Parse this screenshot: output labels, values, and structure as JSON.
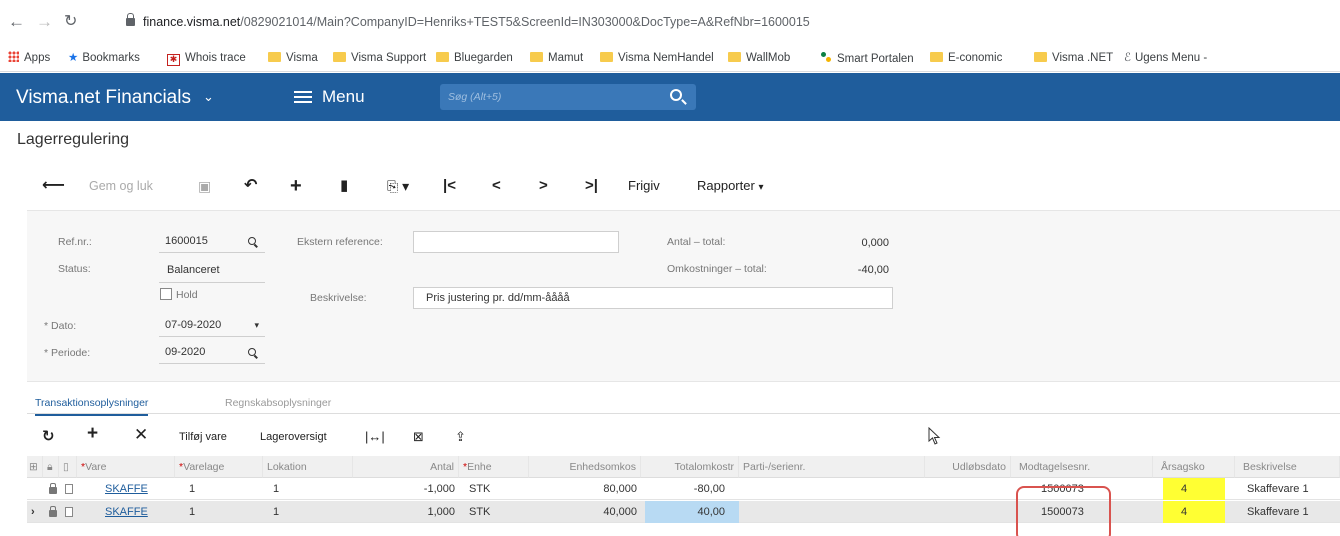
{
  "browser": {
    "url_host": "finance.visma.net",
    "url_path": "/0829021014/Main?CompanyID=Henriks+TEST5&ScreenId=IN303000&DocType=A&RefNbr=1600015",
    "bookmarks": [
      "Apps",
      "Bookmarks",
      "Whois trace",
      "Visma",
      "Visma Support",
      "Bluegarden",
      "Mamut",
      "Visma NemHandel",
      "WallMob",
      "Smart Portalen",
      "E-conomic",
      "Visma .NET",
      "Ugens Menu -"
    ]
  },
  "header": {
    "app_title": "Visma.net Financials",
    "menu_label": "Menu",
    "search_placeholder": "Søg (Alt+5)"
  },
  "page": {
    "title": "Lagerregulering"
  },
  "toolbar": {
    "save_close": "Gem og luk",
    "release": "Frigiv",
    "reports": "Rapporter"
  },
  "form": {
    "ref_label": "Ref.nr.:",
    "ref_value": "1600015",
    "status_label": "Status:",
    "status_value": "Balanceret",
    "hold_label": "Hold",
    "date_label": "Dato:",
    "date_value": "07-09-2020",
    "period_label": "Periode:",
    "period_value": "09-2020",
    "ext_ref_label": "Ekstern reference:",
    "ext_ref_value": "",
    "desc_label": "Beskrivelse:",
    "desc_value": "Pris justering pr. dd/mm-åååå",
    "qty_total_label": "Antal – total:",
    "qty_total_value": "0,000",
    "cost_total_label": "Omkostninger – total:",
    "cost_total_value": "-40,00"
  },
  "tabs": [
    "Transaktionsoplysninger",
    "Regnskabsoplysninger"
  ],
  "grid_toolbar": {
    "add_item": "Tilføj vare",
    "stock_overview": "Lageroversigt"
  },
  "grid": {
    "headers": {
      "item": "Vare",
      "warehouse": "Varelage",
      "location": "Lokation",
      "qty": "Antal",
      "uom": "Enhe",
      "unit_cost": "Enhedsomkos",
      "ext_cost": "Totalomkostr",
      "lot": "Parti-/serienr.",
      "expiry": "Udløbsdato",
      "receipt": "Modtagelsesnr.",
      "reason": "Årsagsko",
      "desc": "Beskrivelse"
    },
    "rows": [
      {
        "item": "SKAFFE",
        "warehouse": "1",
        "location": "1",
        "qty": "-1,000",
        "uom": "STK",
        "unit_cost": "80,000",
        "ext_cost": "-80,00",
        "receipt": "1500073",
        "reason": "4",
        "desc": "Skaffevare 1"
      },
      {
        "item": "SKAFFE",
        "warehouse": "1",
        "location": "1",
        "qty": "1,000",
        "uom": "STK",
        "unit_cost": "40,000",
        "ext_cost": "40,00",
        "receipt": "1500073",
        "reason": "4",
        "desc": "Skaffevare 1"
      }
    ]
  },
  "colors": {
    "header_bg": "#1f5d9c",
    "highlight": "#ffff33",
    "annotation": "#d9534f"
  }
}
